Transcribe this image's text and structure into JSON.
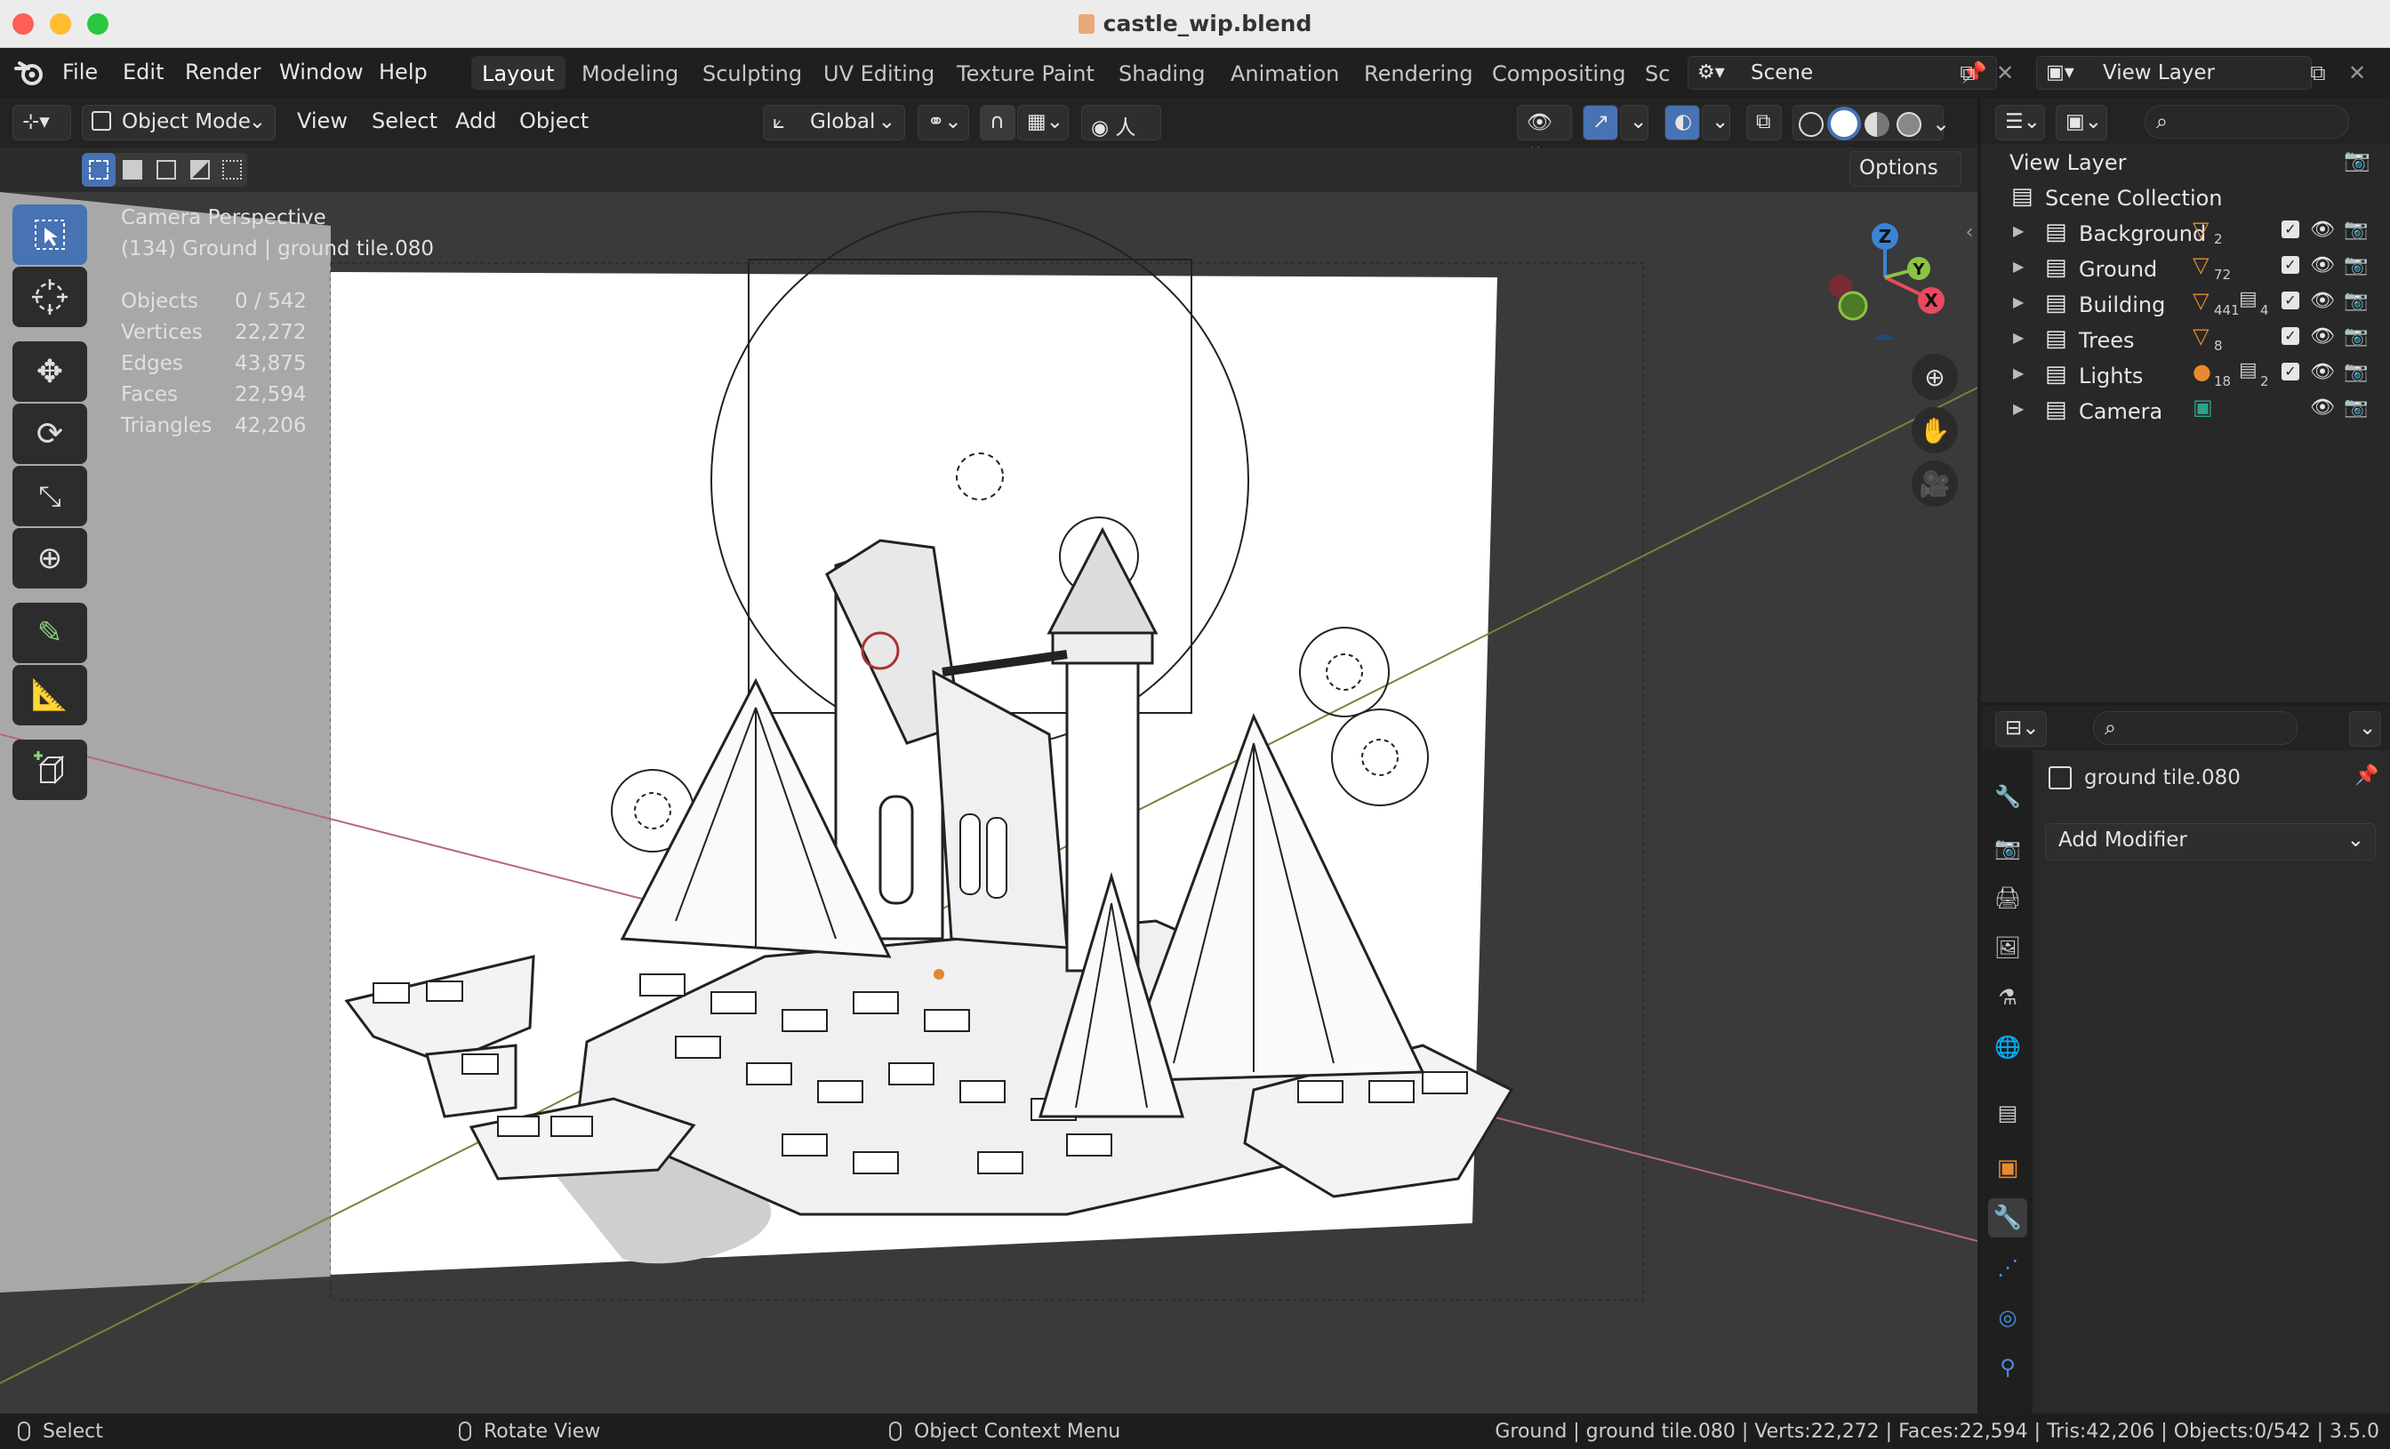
{
  "window": {
    "title": "castle_wip.blend"
  },
  "menu": {
    "items": [
      "File",
      "Edit",
      "Render",
      "Window",
      "Help"
    ],
    "workspaces": [
      "Layout",
      "Modeling",
      "Sculpting",
      "UV Editing",
      "Texture Paint",
      "Shading",
      "Animation",
      "Rendering",
      "Compositing",
      "Sc"
    ],
    "scene_name": "Scene",
    "view_layer_name": "View Layer"
  },
  "header": {
    "mode": "Object Mode",
    "menus": [
      "View",
      "Select",
      "Add",
      "Object"
    ],
    "transform_orientation": "Global",
    "options": "Options"
  },
  "viewport": {
    "view_name": "Camera Perspective",
    "active_info": "(134) Ground | ground tile.080",
    "stats": [
      {
        "label": "Objects",
        "value": "0 / 542"
      },
      {
        "label": "Vertices",
        "value": "22,272"
      },
      {
        "label": "Edges",
        "value": "43,875"
      },
      {
        "label": "Faces",
        "value": "22,594"
      },
      {
        "label": "Triangles",
        "value": "42,206"
      }
    ],
    "gizmo": {
      "x": "X",
      "y": "Y",
      "z": "Z"
    }
  },
  "outliner": {
    "root": "View Layer",
    "scene_collection": "Scene Collection",
    "collections": [
      {
        "name": "Background",
        "badge": "2"
      },
      {
        "name": "Ground",
        "badge": "72"
      },
      {
        "name": "Building",
        "badge": "441",
        "badge2": "4"
      },
      {
        "name": "Trees",
        "badge": "8"
      },
      {
        "name": "Lights",
        "badge": "18",
        "badge2": "2"
      },
      {
        "name": "Camera",
        "badge": ""
      }
    ]
  },
  "properties": {
    "object_name": "ground tile.080",
    "add_modifier": "Add Modifier"
  },
  "statusbar": {
    "left_action": "Select",
    "middle_action": "Rotate View",
    "right_action": "Object Context Menu",
    "info": "Ground | ground tile.080 | Verts:22,272 | Faces:22,594 | Tris:42,206 | Objects:0/542 | 3.5.0"
  },
  "colors": {
    "accent": "#4772b3",
    "x_axis": "#e84a5f",
    "y_axis": "#8cc342",
    "z_axis": "#3b83d6"
  }
}
